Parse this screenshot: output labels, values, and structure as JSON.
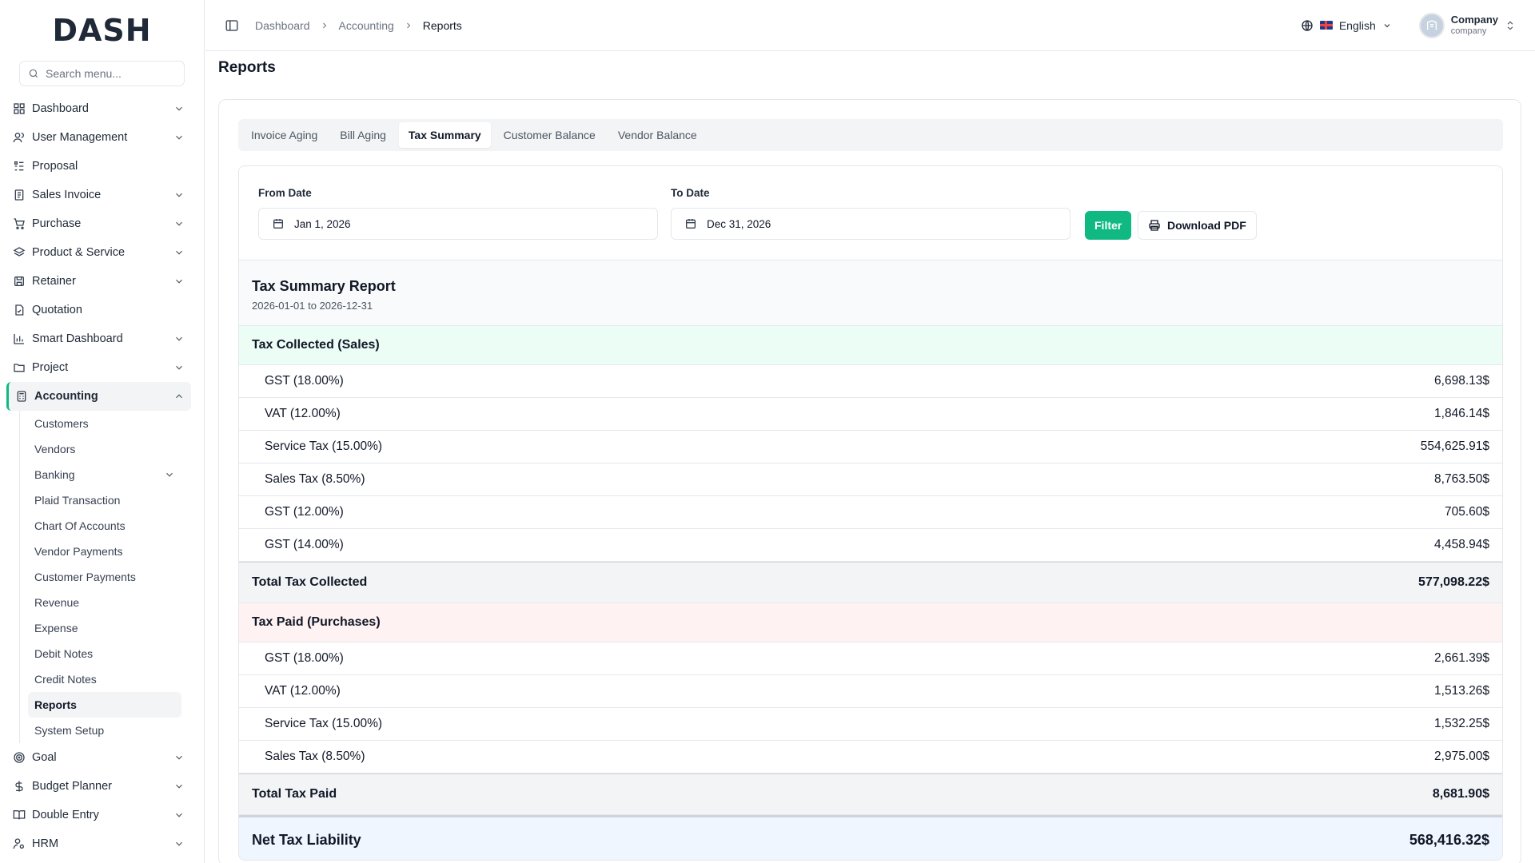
{
  "app": {
    "logo": "DASH"
  },
  "sidebar": {
    "search_placeholder": "Search menu...",
    "items": [
      {
        "label": "Dashboard",
        "chevron": "down"
      },
      {
        "label": "User Management",
        "chevron": "down"
      },
      {
        "label": "Proposal"
      },
      {
        "label": "Sales Invoice",
        "chevron": "down"
      },
      {
        "label": "Purchase",
        "chevron": "down"
      },
      {
        "label": "Product & Service",
        "chevron": "down"
      },
      {
        "label": "Retainer",
        "chevron": "down"
      },
      {
        "label": "Quotation"
      },
      {
        "label": "Smart Dashboard",
        "chevron": "down"
      },
      {
        "label": "Project",
        "chevron": "down"
      },
      {
        "label": "Accounting",
        "chevron": "up"
      }
    ],
    "accounting_sub": [
      "Customers",
      "Vendors",
      "Banking",
      "Plaid Transaction",
      "Chart Of Accounts",
      "Vendor Payments",
      "Customer Payments",
      "Revenue",
      "Expense",
      "Debit Notes",
      "Credit Notes",
      "Reports",
      "System Setup"
    ],
    "bottom_items": [
      {
        "label": "Goal"
      },
      {
        "label": "Budget Planner"
      },
      {
        "label": "Double Entry"
      },
      {
        "label": "HRM"
      }
    ]
  },
  "header": {
    "breadcrumbs": [
      "Dashboard",
      "Accounting",
      "Reports"
    ],
    "language": "English",
    "company_name": "Company",
    "company_sub": "company"
  },
  "page": {
    "title": "Reports"
  },
  "tabs": [
    "Invoice Aging",
    "Bill Aging",
    "Tax Summary",
    "Customer Balance",
    "Vendor Balance"
  ],
  "filters": {
    "from_label": "From Date",
    "from_value": "Jan 1, 2026",
    "to_label": "To Date",
    "to_value": "Dec 31, 2026",
    "filter_button": "Filter",
    "pdf_button": "Download PDF"
  },
  "report": {
    "title": "Tax Summary Report",
    "range": "2026-01-01 to 2026-12-31",
    "collected": {
      "heading": "Tax Collected (Sales)",
      "rows": [
        {
          "name": "GST (18.00%)",
          "amount": "6,698.13$"
        },
        {
          "name": "VAT (12.00%)",
          "amount": "1,846.14$"
        },
        {
          "name": "Service Tax (15.00%)",
          "amount": "554,625.91$"
        },
        {
          "name": "Sales Tax (8.50%)",
          "amount": "8,763.50$"
        },
        {
          "name": "GST (12.00%)",
          "amount": "705.60$"
        },
        {
          "name": "GST (14.00%)",
          "amount": "4,458.94$"
        }
      ],
      "total_label": "Total Tax Collected",
      "total_amount": "577,098.22$"
    },
    "paid": {
      "heading": "Tax Paid (Purchases)",
      "rows": [
        {
          "name": "GST (18.00%)",
          "amount": "2,661.39$"
        },
        {
          "name": "VAT (12.00%)",
          "amount": "1,513.26$"
        },
        {
          "name": "Service Tax (15.00%)",
          "amount": "1,532.25$"
        },
        {
          "name": "Sales Tax (8.50%)",
          "amount": "2,975.00$"
        }
      ],
      "total_label": "Total Tax Paid",
      "total_amount": "8,681.90$"
    },
    "net_label": "Net Tax Liability",
    "net_amount": "568,416.32$"
  },
  "colors": {
    "accent": "#10b981",
    "collected_bg": "#ecfdf5",
    "paid_bg": "#fef2f2",
    "net_bg": "#eff6ff"
  }
}
